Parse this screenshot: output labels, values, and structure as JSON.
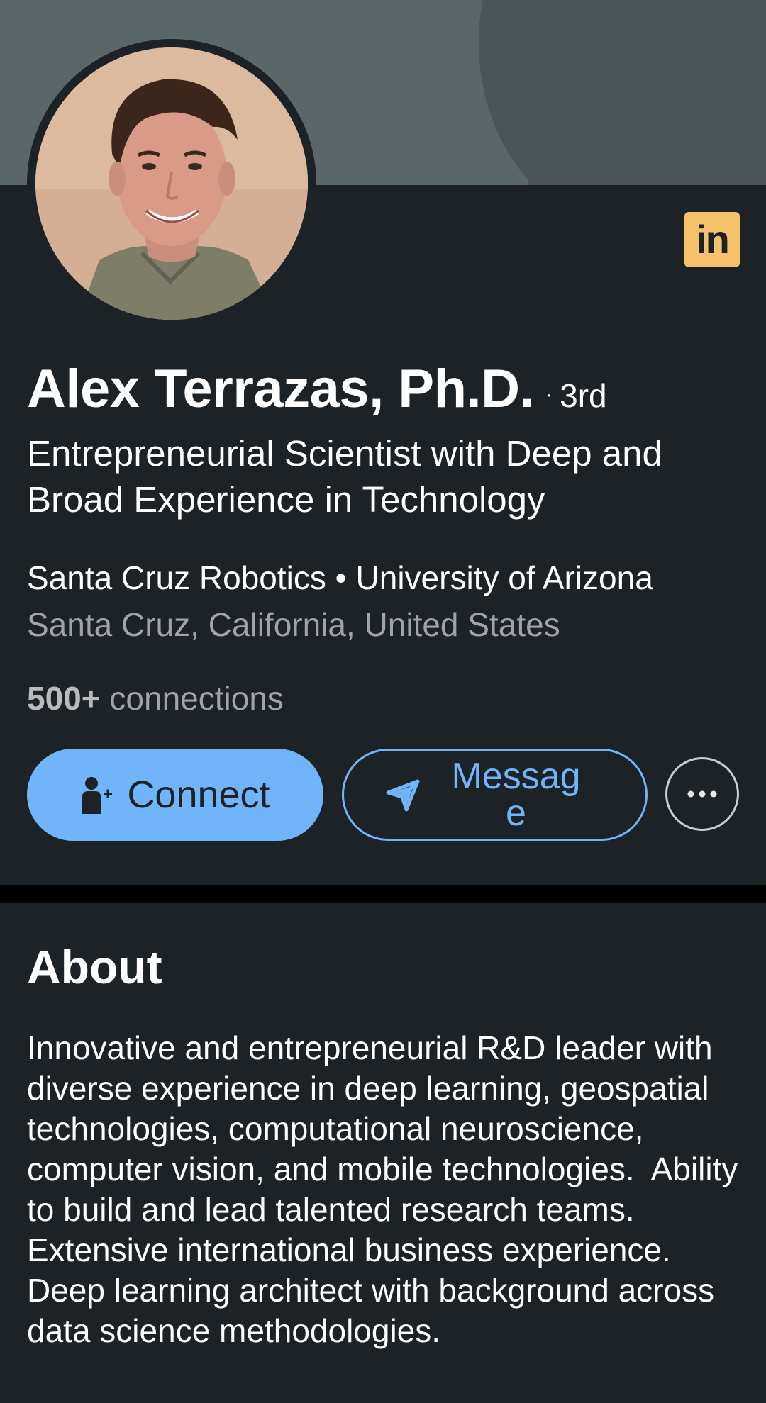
{
  "profile": {
    "name": "Alex Terrazas, Ph.D.",
    "degree_separator": "·",
    "degree": "3rd",
    "headline": "Entrepreneurial Scientist with Deep and Broad Experience in Technology",
    "company_line": "Santa Cruz Robotics • University of Arizona",
    "location": "Santa Cruz, California, United States",
    "connections_count": "500+",
    "connections_label": " connections",
    "badge_text": "in"
  },
  "actions": {
    "connect_label": "Connect",
    "message_label": "Message",
    "more_icon": "more-horizontal-icon"
  },
  "about": {
    "title": "About",
    "text": "Innovative and entrepreneurial R&D leader with diverse experience in deep learning, geospatial technologies, computational neuroscience, computer vision, and mobile technologies.  Ability to build and lead talented research teams. Extensive international business experience.  Deep learning architect with background across data science methodologies."
  },
  "colors": {
    "background": "#1d2226",
    "accent": "#70b5f9",
    "badge": "#f5c26b",
    "secondary_text": "#a0a4a8"
  }
}
